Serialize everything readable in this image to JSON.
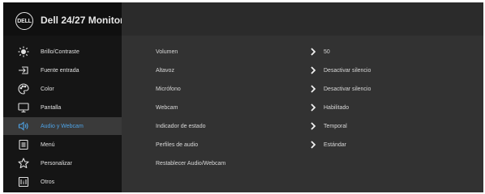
{
  "header": {
    "brand_logo_text": "DELL",
    "title": "Dell 24/27 Monitor"
  },
  "sidebar": {
    "items": [
      {
        "label": "Brillo/Contraste",
        "icon": "brightness-icon"
      },
      {
        "label": "Fuente entrada",
        "icon": "input-source-icon"
      },
      {
        "label": "Color",
        "icon": "color-palette-icon"
      },
      {
        "label": "Pantalla",
        "icon": "display-icon"
      },
      {
        "label": "Audio y Webcam",
        "icon": "speaker-icon",
        "selected": true
      },
      {
        "label": "Menú",
        "icon": "menu-icon"
      },
      {
        "label": "Personalizar",
        "icon": "star-icon"
      },
      {
        "label": "Otros",
        "icon": "others-icon"
      }
    ]
  },
  "main": {
    "rows": [
      {
        "label": "Volumen",
        "value": "50",
        "has_arrow": true
      },
      {
        "label": "Altavoz",
        "value": "Desactivar silencio",
        "has_arrow": true
      },
      {
        "label": "Micrófono",
        "value": "Desactivar silencio",
        "has_arrow": true
      },
      {
        "label": "Webcam",
        "value": "Habilitado",
        "has_arrow": true
      },
      {
        "label": "Indicador de estado",
        "value": "Temporal",
        "has_arrow": true
      },
      {
        "label": "Perfiles de audio",
        "value": "Estándar",
        "has_arrow": true
      },
      {
        "label": "Restablecer Audio/Webcam",
        "value": "",
        "has_arrow": false
      }
    ]
  },
  "colors": {
    "osd_background": "#323232",
    "sidebar_background": "#151515",
    "selected_accent": "#4ea3e6",
    "text": "#e0e0e0"
  }
}
